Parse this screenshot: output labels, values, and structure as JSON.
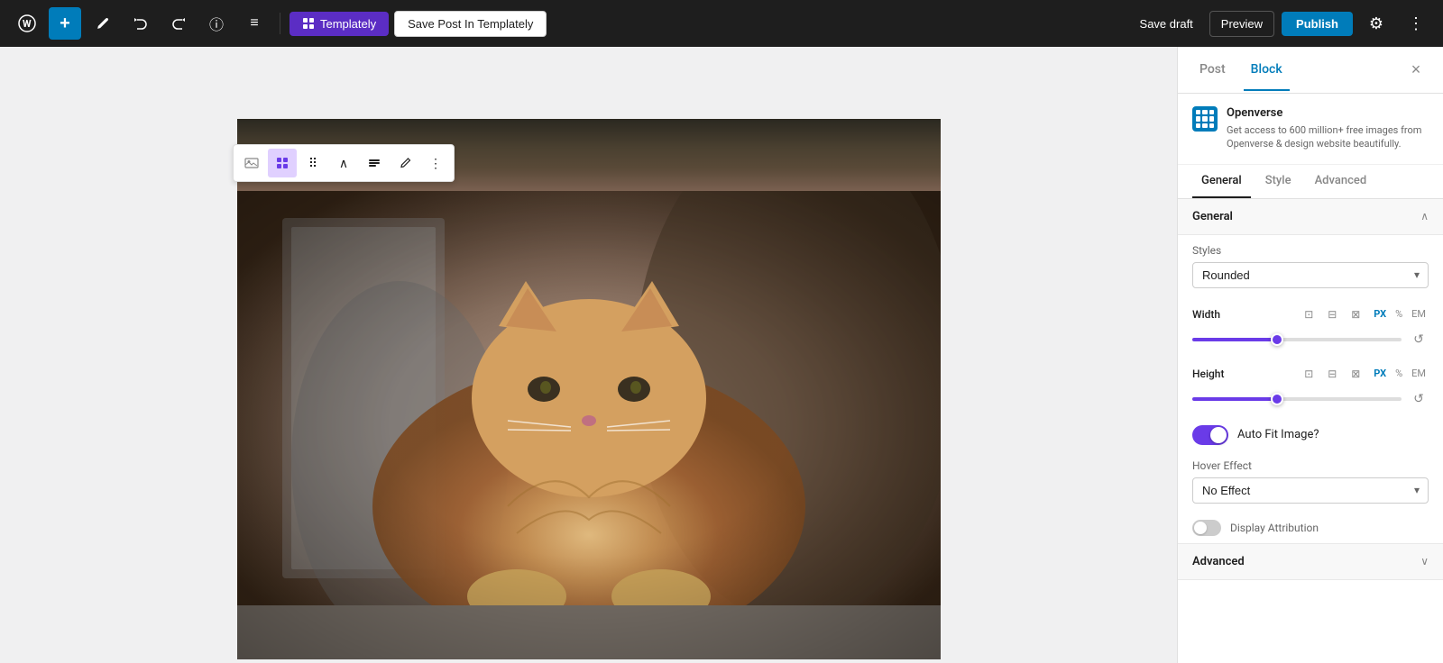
{
  "toolbar": {
    "add_label": "+",
    "templately_label": "Templately",
    "save_templately_label": "Save Post In Templately",
    "save_draft_label": "Save draft",
    "preview_label": "Preview",
    "publish_label": "Publish"
  },
  "block_toolbar": {
    "buttons": [
      "image",
      "grid",
      "dots",
      "up",
      "align",
      "pencil",
      "more"
    ]
  },
  "sidebar": {
    "post_tab": "Post",
    "block_tab": "Block",
    "close_label": "×",
    "openverse": {
      "title": "Openverse",
      "description": "Get access to 600 million+ free images from Openverse & design website beautifully."
    },
    "tabs": [
      "General",
      "Style",
      "Advanced"
    ],
    "active_tab": "General",
    "general_section": {
      "title": "General",
      "styles_label": "Styles",
      "styles_value": "Rounded",
      "width_label": "Width",
      "width_units": [
        "PX",
        "%",
        "EM"
      ],
      "height_label": "Height",
      "height_units": [
        "PX",
        "%",
        "EM"
      ],
      "auto_fit_label": "Auto Fit Image?",
      "auto_fit_on": true,
      "hover_effect_label": "Hover Effect",
      "hover_effect_value": "No Effect",
      "display_attribution_label": "Display Attribution",
      "display_attribution_on": false
    },
    "advanced_section": {
      "title": "Advanced"
    }
  }
}
